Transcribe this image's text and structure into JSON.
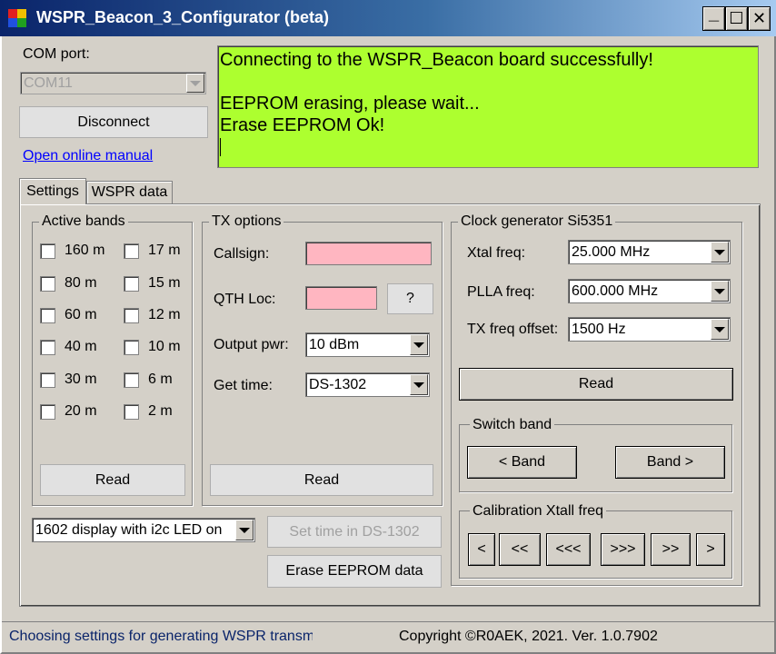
{
  "window": {
    "title": "WSPR_Beacon_3_Configurator (beta)",
    "controls": {
      "minimize": "_",
      "maximize": "☐",
      "close": "✕"
    }
  },
  "connection": {
    "com_port_label": "COM port:",
    "com_port_value": "COM11",
    "disconnect_label": "Disconnect",
    "manual_link": "Open online manual"
  },
  "log": {
    "lines": [
      "Connecting to the WSPR_Beacon board successfully!",
      "",
      "EEPROM erasing, please wait...",
      "Erase EEPROM Ok!"
    ],
    "background": "#adff2f"
  },
  "tabs": [
    {
      "label": "Settings",
      "active": true
    },
    {
      "label": "WSPR data",
      "active": false
    }
  ],
  "active_bands": {
    "title": "Active bands",
    "col1": [
      "160 m",
      "80 m",
      "60 m",
      "40 m",
      "30 m",
      "20 m"
    ],
    "col2": [
      "17 m",
      "15 m",
      "12 m",
      "10 m",
      "6 m",
      "2 m"
    ],
    "read_label": "Read"
  },
  "tx_options": {
    "title": "TX options",
    "callsign_label": "Callsign:",
    "callsign_value": "",
    "qth_label": "QTH Loc:",
    "qth_value": "",
    "qth_help": "?",
    "output_pwr_label": "Output pwr:",
    "output_pwr_value": "10 dBm",
    "get_time_label": "Get time:",
    "get_time_value": "DS-1302",
    "read_label": "Read",
    "field_color": "#ffb6c1"
  },
  "display_select": {
    "value": "1602 display with i2c LED on"
  },
  "actions": {
    "set_time_label": "Set time in DS-1302",
    "erase_label": "Erase EEPROM data"
  },
  "clock_gen": {
    "title": "Clock generator Si5351",
    "xtal_label": "Xtal freq:",
    "xtal_value": "25.000 MHz",
    "plla_label": "PLLA freq:",
    "plla_value": "600.000 MHz",
    "tx_offset_label": "TX freq offset:",
    "tx_offset_value": "1500 Hz",
    "read_label": "Read"
  },
  "switch_band": {
    "title": "Switch band",
    "prev_label": "< Band",
    "next_label": "Band >"
  },
  "calibration": {
    "title": "Calibration Xtall freq",
    "buttons": [
      "<",
      "<<",
      "<<<",
      ">>>",
      ">>",
      ">"
    ]
  },
  "status": {
    "left": "Choosing settings for generating WSPR transmission",
    "right": "Copyright ©R0AEK, 2021. Ver. 1.0.7902"
  }
}
